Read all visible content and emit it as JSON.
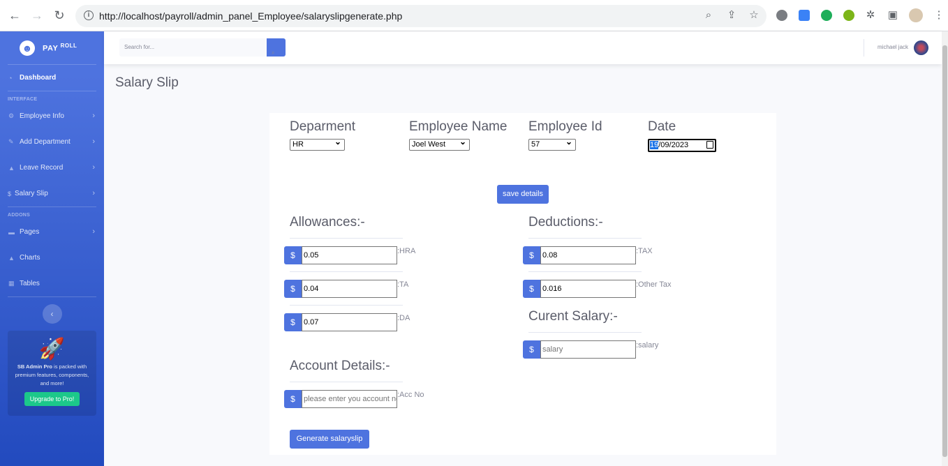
{
  "browser": {
    "url": "http://localhost/payroll/admin_panel_Employee/salaryslipgenerate.php"
  },
  "sidebar": {
    "brand": "PAY",
    "brand_sup": "ROLL",
    "dashboard": "Dashboard",
    "heading_interface": "INTERFACE",
    "items": [
      {
        "label": "Employee Info"
      },
      {
        "label": "Add Department"
      },
      {
        "label": "Leave Record"
      },
      {
        "label": "Salary Slip"
      }
    ],
    "heading_addons": "ADDONS",
    "addons": [
      {
        "label": "Pages"
      },
      {
        "label": "Charts"
      },
      {
        "label": "Tables"
      }
    ],
    "promo_bold": "SB Admin Pro",
    "promo_text": " is packed with premium features, components, and more!",
    "promo_button": "Upgrade to Pro!"
  },
  "topbar": {
    "search_placeholder": "Search for...",
    "username": "michael jack"
  },
  "page": {
    "title": "Salary Slip"
  },
  "form": {
    "department_label": "Deparment",
    "department_value": "HR",
    "employee_name_label": "Employee Name",
    "employee_name_value": "Joel West",
    "employee_id_label": "Employee Id",
    "employee_id_value": "57",
    "date_label": "Date",
    "date_day": "19",
    "date_rest": "/09/2023",
    "save_button": "save details",
    "allowances_heading": "Allowances:-",
    "hra_value": "0.05",
    "hra_label": ":HRA",
    "ta_value": "0.04",
    "ta_label": ":TA",
    "da_value": "0.07",
    "da_label": ":DA",
    "deductions_heading": "Deductions:-",
    "tax_value": "0.08",
    "tax_label": ":TAX",
    "other_tax_value": "0.016",
    "other_tax_label": ":Other Tax",
    "current_salary_heading": "Curent Salary:-",
    "salary_placeholder": "salary",
    "salary_label": ":salary",
    "account_heading": "Account Details:-",
    "account_placeholder": "please enter you account no",
    "account_label": ":Acc No",
    "currency_symbol": "$",
    "generate_button": "Generate salaryslip"
  }
}
